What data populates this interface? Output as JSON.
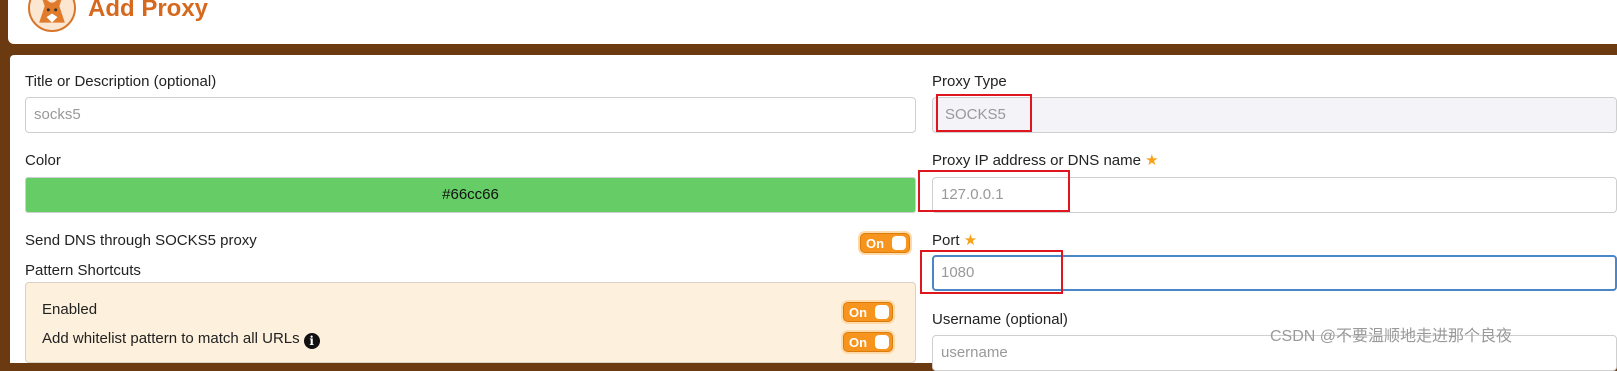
{
  "header": {
    "title": "Add Proxy"
  },
  "form": {
    "title_field": {
      "label": "Title or Description (optional)",
      "value": "socks5"
    },
    "color_field": {
      "label": "Color",
      "value": "#66cc66"
    },
    "send_dns": {
      "label": "Send DNS through SOCKS5 proxy",
      "toggle": "On"
    },
    "pattern_shortcuts": {
      "label": "Pattern Shortcuts",
      "enabled_label": "Enabled",
      "enabled_toggle": "On",
      "whitelist_label": "Add whitelist pattern to match all URLs",
      "whitelist_toggle": "On"
    },
    "proxy_type": {
      "label": "Proxy Type",
      "value": "SOCKS5"
    },
    "proxy_ip": {
      "label": "Proxy IP address or DNS name",
      "placeholder": "127.0.0.1"
    },
    "port": {
      "label": "Port",
      "placeholder": "1080"
    },
    "username": {
      "label": "Username (optional)",
      "placeholder": "username"
    }
  },
  "watermark": "CSDN @不要温顺地走进那个良夜",
  "colors": {
    "accent": "#f7941d",
    "title": "#d7691e",
    "frame": "#6b3a10",
    "proxy_color": "#66cc66",
    "highlight": "#e0161f"
  },
  "icons": {
    "logo": "fox-logo-icon",
    "required": "star-icon",
    "info": "info-circle-icon"
  }
}
